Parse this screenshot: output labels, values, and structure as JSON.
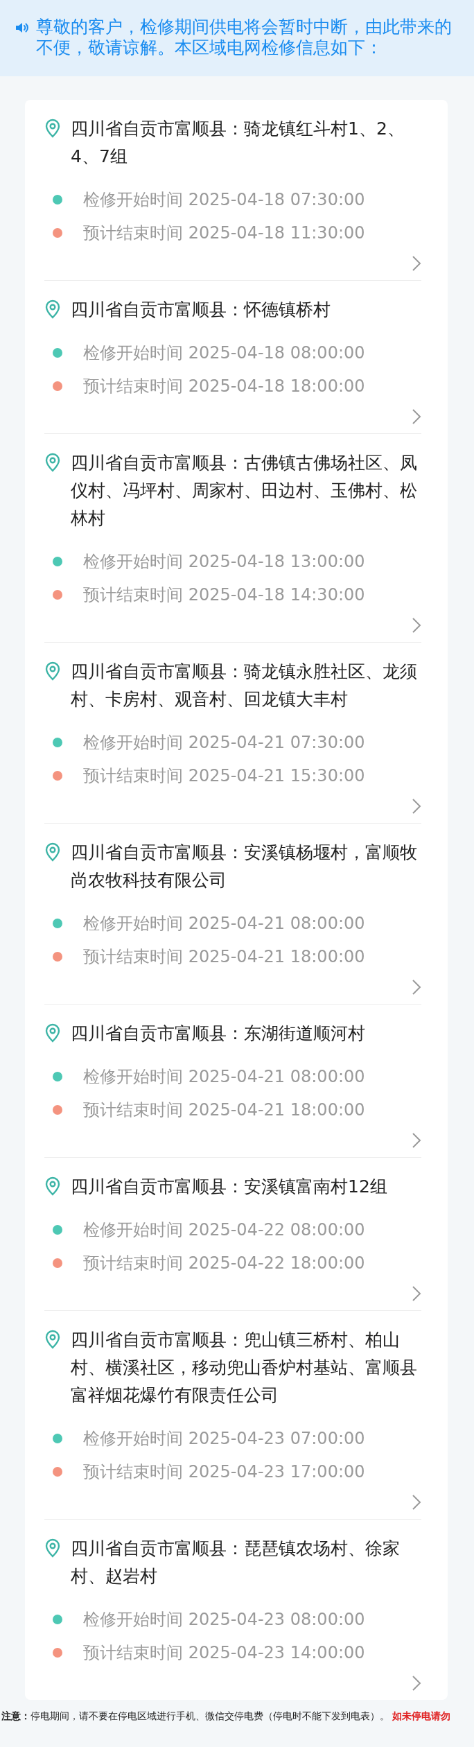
{
  "notice": "尊敬的客户，检修期间供电将会暂时中断，由此带来的不便，敬请谅解。本区域电网检修信息如下：",
  "outages": [
    {
      "address": "四川省自贡市富顺县：骑龙镇红斗村1、2、4、7组",
      "start": "检修开始时间 2025-04-18 07:30:00",
      "end": "预计结束时间 2025-04-18 11:30:00"
    },
    {
      "address": "四川省自贡市富顺县：怀德镇桥村",
      "start": "检修开始时间 2025-04-18 08:00:00",
      "end": "预计结束时间 2025-04-18 18:00:00"
    },
    {
      "address": "四川省自贡市富顺县：古佛镇古佛场社区、凤仪村、冯坪村、周家村、田边村、玉佛村、松林村",
      "start": "检修开始时间 2025-04-18 13:00:00",
      "end": "预计结束时间 2025-04-18 14:30:00"
    },
    {
      "address": "四川省自贡市富顺县：骑龙镇永胜社区、龙须村、卡房村、观音村、回龙镇大丰村",
      "start": "检修开始时间 2025-04-21 07:30:00",
      "end": "预计结束时间 2025-04-21 15:30:00"
    },
    {
      "address": "四川省自贡市富顺县：安溪镇杨堰村，富顺牧尚农牧科技有限公司",
      "start": "检修开始时间 2025-04-21 08:00:00",
      "end": "预计结束时间 2025-04-21 18:00:00"
    },
    {
      "address": "四川省自贡市富顺县：东湖街道顺河村",
      "start": "检修开始时间 2025-04-21 08:00:00",
      "end": "预计结束时间 2025-04-21 18:00:00"
    },
    {
      "address": "四川省自贡市富顺县：安溪镇富南村12组",
      "start": "检修开始时间 2025-04-22 08:00:00",
      "end": "预计结束时间 2025-04-22 18:00:00"
    },
    {
      "address": "四川省自贡市富顺县：兜山镇三桥村、柏山村、横溪社区，移动兜山香炉村基站、富顺县富祥烟花爆竹有限责任公司",
      "start": "检修开始时间 2025-04-23 07:00:00",
      "end": "预计结束时间 2025-04-23 17:00:00"
    },
    {
      "address": "四川省自贡市富顺县：琵琶镇农场村、徐家村、赵岩村",
      "start": "检修开始时间 2025-04-23 08:00:00",
      "end": "预计结束时间 2025-04-23 14:00:00"
    }
  ],
  "note": "**注意：**停电期间，请不要在停电区域进行手机、微信交停电费（停电时不能下发到电表）。",
  "warning": "如未停电请勿"
}
